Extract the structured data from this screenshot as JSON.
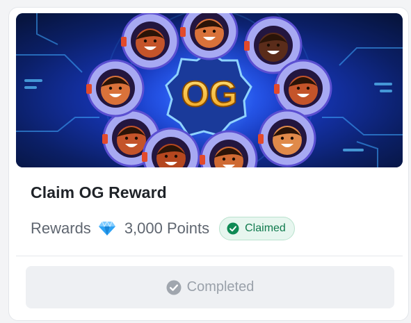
{
  "card": {
    "banner": {
      "image": "og-astronauts-banner",
      "emblem_text": "OG"
    },
    "title": "Claim OG Reward",
    "rewards": {
      "label": "Rewards",
      "icon": "diamond-icon",
      "points": "3,000 Points"
    },
    "status_badge": {
      "icon": "check-circle-icon",
      "label": "Claimed"
    },
    "action": {
      "icon": "check-circle-icon",
      "label": "Completed",
      "disabled": true
    }
  },
  "colors": {
    "badge_bg": "#e7f6ef",
    "badge_text": "#0f7a4d",
    "disabled_bg": "#eef0f3",
    "disabled_text": "#9aa1aa",
    "gem": "#2fa3f5"
  }
}
